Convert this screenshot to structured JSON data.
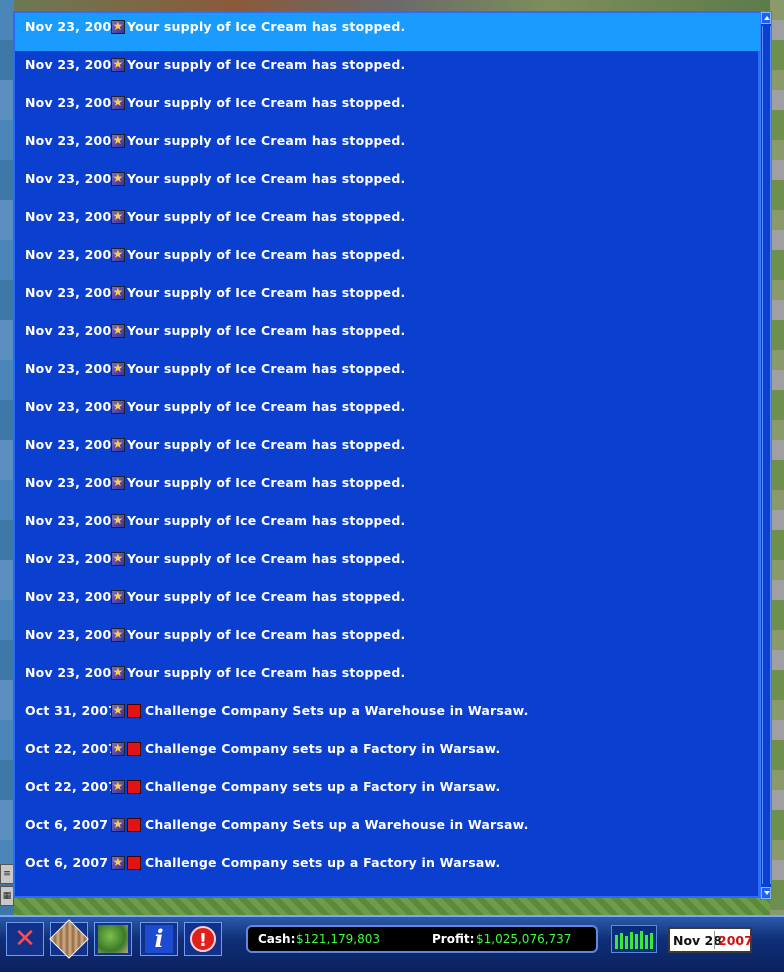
{
  "messages": [
    {
      "date": "Nov 23, 2007",
      "kind": "ice",
      "text": "Your supply of Ice Cream has stopped.",
      "selected": true
    },
    {
      "date": "Nov 23, 2007",
      "kind": "ice",
      "text": "Your supply of Ice Cream has stopped."
    },
    {
      "date": "Nov 23, 2007",
      "kind": "ice",
      "text": "Your supply of Ice Cream has stopped."
    },
    {
      "date": "Nov 23, 2007",
      "kind": "ice",
      "text": "Your supply of Ice Cream has stopped."
    },
    {
      "date": "Nov 23, 2007",
      "kind": "ice",
      "text": "Your supply of Ice Cream has stopped."
    },
    {
      "date": "Nov 23, 2007",
      "kind": "ice",
      "text": "Your supply of Ice Cream has stopped."
    },
    {
      "date": "Nov 23, 2007",
      "kind": "ice",
      "text": "Your supply of Ice Cream has stopped."
    },
    {
      "date": "Nov 23, 2007",
      "kind": "ice",
      "text": "Your supply of Ice Cream has stopped."
    },
    {
      "date": "Nov 23, 2007",
      "kind": "ice",
      "text": "Your supply of Ice Cream has stopped."
    },
    {
      "date": "Nov 23, 2007",
      "kind": "ice",
      "text": "Your supply of Ice Cream has stopped."
    },
    {
      "date": "Nov 23, 2007",
      "kind": "ice",
      "text": "Your supply of Ice Cream has stopped."
    },
    {
      "date": "Nov 23, 2007",
      "kind": "ice",
      "text": "Your supply of Ice Cream has stopped."
    },
    {
      "date": "Nov 23, 2007",
      "kind": "ice",
      "text": "Your supply of Ice Cream has stopped."
    },
    {
      "date": "Nov 23, 2007",
      "kind": "ice",
      "text": "Your supply of Ice Cream has stopped."
    },
    {
      "date": "Nov 23, 2007",
      "kind": "ice",
      "text": "Your supply of Ice Cream has stopped."
    },
    {
      "date": "Nov 23, 2007",
      "kind": "ice",
      "text": "Your supply of Ice Cream has stopped."
    },
    {
      "date": "Nov 23, 2007",
      "kind": "ice",
      "text": "Your supply of Ice Cream has stopped."
    },
    {
      "date": "Nov 23, 2007",
      "kind": "ice",
      "text": "Your supply of Ice Cream has stopped."
    },
    {
      "date": "Oct 31, 2007",
      "kind": "co",
      "text": "Challenge Company Sets up a Warehouse in Warsaw."
    },
    {
      "date": "Oct 22, 2007",
      "kind": "co",
      "text": "Challenge Company sets up a Factory in Warsaw."
    },
    {
      "date": "Oct 22, 2007",
      "kind": "co",
      "text": "Challenge Company sets up a Factory in Warsaw."
    },
    {
      "date": "Oct 6, 2007",
      "kind": "co",
      "text": "Challenge Company Sets up a Warehouse in Warsaw."
    },
    {
      "date": "Oct 6, 2007",
      "kind": "co",
      "text": "Challenge Company sets up a Factory in Warsaw."
    }
  ],
  "toolbar": {
    "cash_label": "Cash:",
    "cash_value": "$121,179,803",
    "profit_label": "Profit:",
    "profit_value": "$1,025,076,737",
    "date_md": "Nov 28",
    "date_year": "2007"
  },
  "icons": {
    "close": "x-icon",
    "map": "map-grid-icon",
    "globe": "world-map-icon",
    "info": "info-icon",
    "alert": "alert-icon",
    "chart": "bar-chart-icon"
  },
  "colors": {
    "panel_bg": "#0a3fd0",
    "selected_row": "#1a9cff",
    "money_green": "#3cff3c",
    "year_red": "#d01010"
  }
}
